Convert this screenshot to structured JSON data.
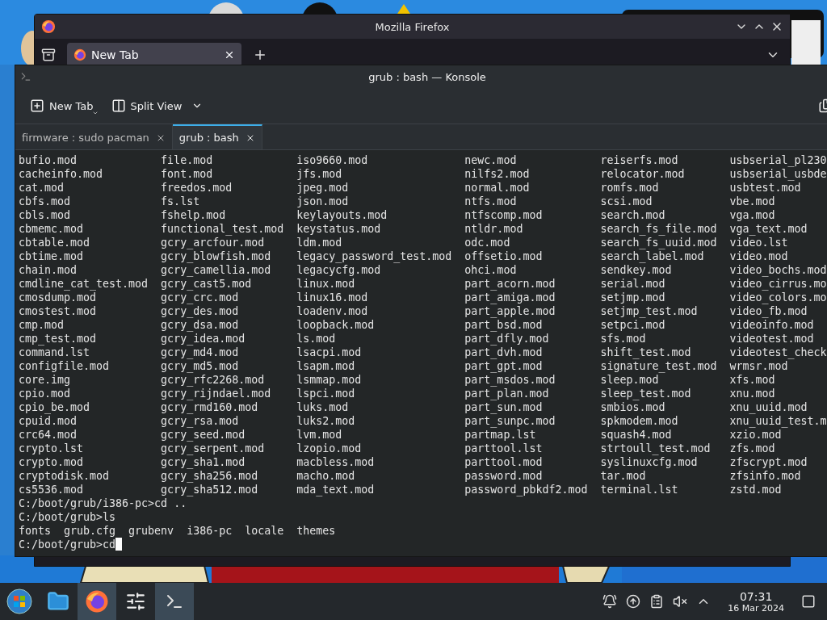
{
  "firefox": {
    "title": "Mozilla Firefox",
    "tabs": [
      {
        "label": "New Tab",
        "selected": true
      }
    ]
  },
  "konsole": {
    "title": "grub : bash — Konsole",
    "toolbar": [
      {
        "label": "New Tab",
        "kind": "new-tab"
      },
      {
        "label": "Split View",
        "kind": "split-view"
      }
    ],
    "tabs": [
      {
        "label": "firmware : sudo pacman",
        "selected": false
      },
      {
        "label": "grub : bash",
        "selected": true
      }
    ],
    "listing": [
      [
        "bufio.mod",
        "file.mod",
        "iso9660.mod",
        "newc.mod",
        "reiserfs.mod",
        "usbserial_pl230"
      ],
      [
        "cacheinfo.mod",
        "font.mod",
        "jfs.mod",
        "nilfs2.mod",
        "relocator.mod",
        "usbserial_usbde"
      ],
      [
        "cat.mod",
        "freedos.mod",
        "jpeg.mod",
        "normal.mod",
        "romfs.mod",
        "usbtest.mod"
      ],
      [
        "cbfs.mod",
        "fs.lst",
        "json.mod",
        "ntfs.mod",
        "scsi.mod",
        "vbe.mod"
      ],
      [
        "cbls.mod",
        "fshelp.mod",
        "keylayouts.mod",
        "ntfscomp.mod",
        "search.mod",
        "vga.mod"
      ],
      [
        "cbmemc.mod",
        "functional_test.mod",
        "keystatus.mod",
        "ntldr.mod",
        "search_fs_file.mod",
        "vga_text.mod"
      ],
      [
        "cbtable.mod",
        "gcry_arcfour.mod",
        "ldm.mod",
        "odc.mod",
        "search_fs_uuid.mod",
        "video.lst"
      ],
      [
        "cbtime.mod",
        "gcry_blowfish.mod",
        "legacy_password_test.mod",
        "offsetio.mod",
        "search_label.mod",
        "video.mod"
      ],
      [
        "chain.mod",
        "gcry_camellia.mod",
        "legacycfg.mod",
        "ohci.mod",
        "sendkey.mod",
        "video_bochs.mod"
      ],
      [
        "cmdline_cat_test.mod",
        "gcry_cast5.mod",
        "linux.mod",
        "part_acorn.mod",
        "serial.mod",
        "video_cirrus.mo"
      ],
      [
        "cmosdump.mod",
        "gcry_crc.mod",
        "linux16.mod",
        "part_amiga.mod",
        "setjmp.mod",
        "video_colors.mo"
      ],
      [
        "cmostest.mod",
        "gcry_des.mod",
        "loadenv.mod",
        "part_apple.mod",
        "setjmp_test.mod",
        "video_fb.mod"
      ],
      [
        "cmp.mod",
        "gcry_dsa.mod",
        "loopback.mod",
        "part_bsd.mod",
        "setpci.mod",
        "videoinfo.mod"
      ],
      [
        "cmp_test.mod",
        "gcry_idea.mod",
        "ls.mod",
        "part_dfly.mod",
        "sfs.mod",
        "videotest.mod"
      ],
      [
        "command.lst",
        "gcry_md4.mod",
        "lsacpi.mod",
        "part_dvh.mod",
        "shift_test.mod",
        "videotest_check"
      ],
      [
        "configfile.mod",
        "gcry_md5.mod",
        "lsapm.mod",
        "part_gpt.mod",
        "signature_test.mod",
        "wrmsr.mod"
      ],
      [
        "core.img",
        "gcry_rfc2268.mod",
        "lsmmap.mod",
        "part_msdos.mod",
        "sleep.mod",
        "xfs.mod"
      ],
      [
        "cpio.mod",
        "gcry_rijndael.mod",
        "lspci.mod",
        "part_plan.mod",
        "sleep_test.mod",
        "xnu.mod"
      ],
      [
        "cpio_be.mod",
        "gcry_rmd160.mod",
        "luks.mod",
        "part_sun.mod",
        "smbios.mod",
        "xnu_uuid.mod"
      ],
      [
        "cpuid.mod",
        "gcry_rsa.mod",
        "luks2.mod",
        "part_sunpc.mod",
        "spkmodem.mod",
        "xnu_uuid_test.m"
      ],
      [
        "crc64.mod",
        "gcry_seed.mod",
        "lvm.mod",
        "partmap.lst",
        "squash4.mod",
        "xzio.mod"
      ],
      [
        "crypto.lst",
        "gcry_serpent.mod",
        "lzopio.mod",
        "parttool.lst",
        "strtoull_test.mod",
        "zfs.mod"
      ],
      [
        "crypto.mod",
        "gcry_sha1.mod",
        "macbless.mod",
        "parttool.mod",
        "syslinuxcfg.mod",
        "zfscrypt.mod"
      ],
      [
        "cryptodisk.mod",
        "gcry_sha256.mod",
        "macho.mod",
        "password.mod",
        "tar.mod",
        "zfsinfo.mod"
      ],
      [
        "cs5536.mod",
        "gcry_sha512.mod",
        "mda_text.mod",
        "password_pbkdf2.mod",
        "terminal.lst",
        "zstd.mod"
      ]
    ],
    "lines": [
      "C:/boot/grub/i386-pc>cd ..",
      "C:/boot/grub>ls",
      "fonts  grub.cfg  grubenv  i386-pc  locale  themes"
    ],
    "prompt": "C:/boot/grub>cd"
  },
  "taskbar": {
    "time": "07:31",
    "date": "16 Mar 2024"
  }
}
